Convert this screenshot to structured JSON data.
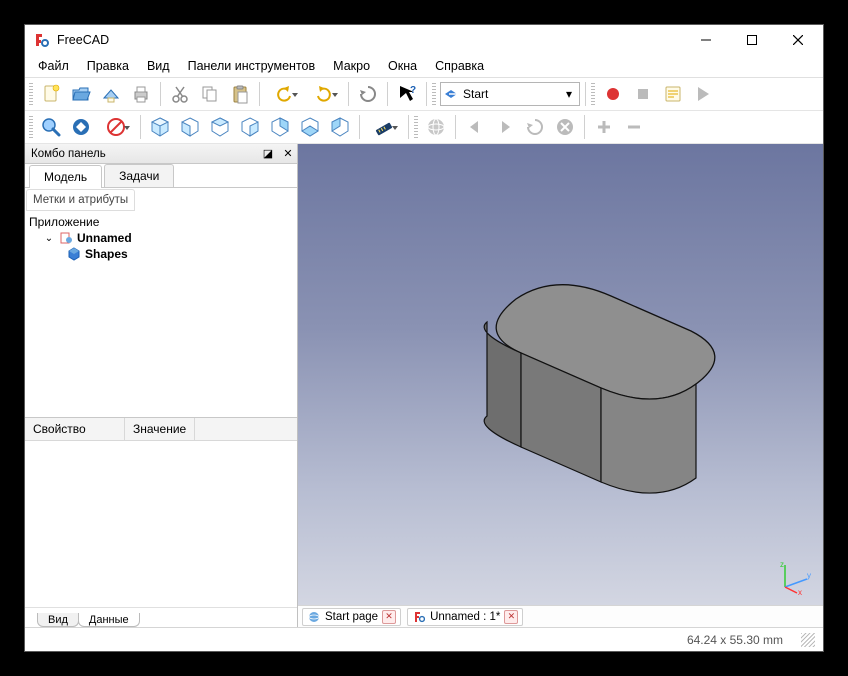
{
  "title": "FreeCAD",
  "menu": {
    "file": "Файл",
    "edit": "Правка",
    "view": "Вид",
    "toolpanels": "Панели инструментов",
    "macro": "Макро",
    "windows": "Окна",
    "help": "Справка"
  },
  "workbench": {
    "label": "Start"
  },
  "combo": {
    "title": "Комбо панель",
    "tab_model": "Модель",
    "tab_tasks": "Задачи",
    "labels_attrs": "Метки и атрибуты",
    "root": "Приложение",
    "doc": "Unnamed",
    "shape": "Shapes",
    "prop_col": "Свойство",
    "val_col": "Значение",
    "bottom_view": "Вид",
    "bottom_data": "Данные"
  },
  "doctabs": {
    "start": "Start page",
    "unnamed": "Unnamed : 1*"
  },
  "status": {
    "coords": "64.24 x 55.30  mm"
  },
  "axes": {
    "x": "x",
    "y": "y",
    "z": "z"
  }
}
